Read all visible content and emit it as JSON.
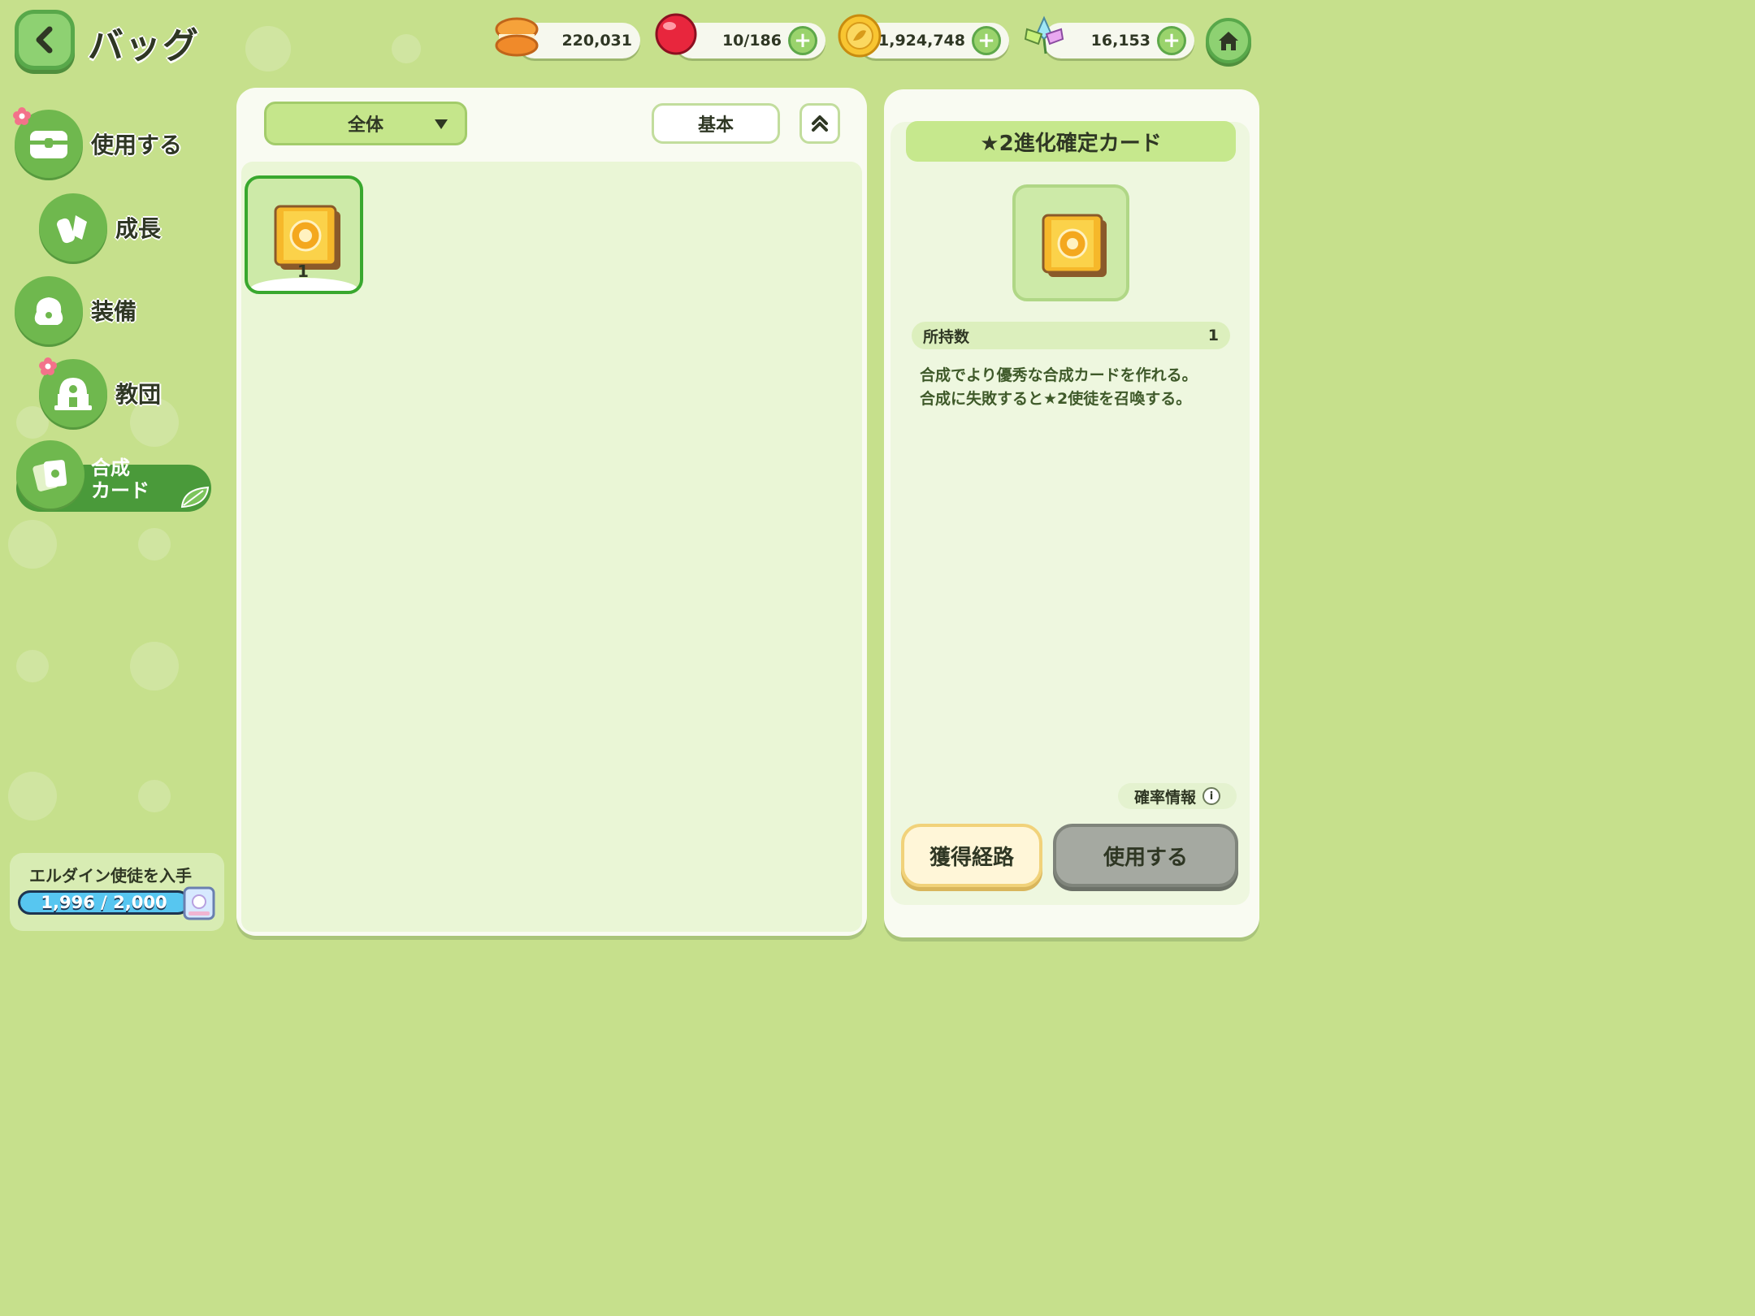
{
  "header": {
    "title": "バッグ",
    "currencies": [
      {
        "icon": "macaron-icon",
        "value": "220,031",
        "has_plus": false
      },
      {
        "icon": "red-gem-icon",
        "value": "10/186",
        "has_plus": true
      },
      {
        "icon": "gold-coin-icon",
        "value": "1,924,748",
        "has_plus": true
      },
      {
        "icon": "crystal-flower-icon",
        "value": "16,153",
        "has_plus": true
      }
    ],
    "plus_label": "+"
  },
  "sidebar": {
    "items": [
      {
        "label": "使用する",
        "icon": "chest-icon",
        "badge": true
      },
      {
        "label": "成長",
        "icon": "potion-icon",
        "badge": false
      },
      {
        "label": "装備",
        "icon": "outfit-icon",
        "badge": false
      },
      {
        "label": "教団",
        "icon": "temple-icon",
        "badge": true
      },
      {
        "label": "合成\nカード",
        "icon": "card-icon",
        "active": true
      }
    ],
    "progress": {
      "label": "エルダイン使徒を入手",
      "current": 1996,
      "max": 2000,
      "text": "1,996 / 2,000"
    }
  },
  "toolbar": {
    "filter_value": "全体",
    "sort_label": "基本"
  },
  "inventory": {
    "items": [
      {
        "icon": "gold-card-icon",
        "count": "1",
        "selected": true
      }
    ]
  },
  "detail": {
    "title": "★2進化確定カード",
    "owned_label": "所持数",
    "owned_value": "1",
    "description": "合成でより優秀な合成カードを作れる。\n合成に失敗すると★2使徒を召喚する。",
    "prob_label": "確率情報",
    "route_button": "獲得経路",
    "use_button": "使用する"
  },
  "colors": {
    "background": "#c6e08c",
    "accent_green": "#4a9a3a",
    "panel": "#f9fbf2"
  }
}
